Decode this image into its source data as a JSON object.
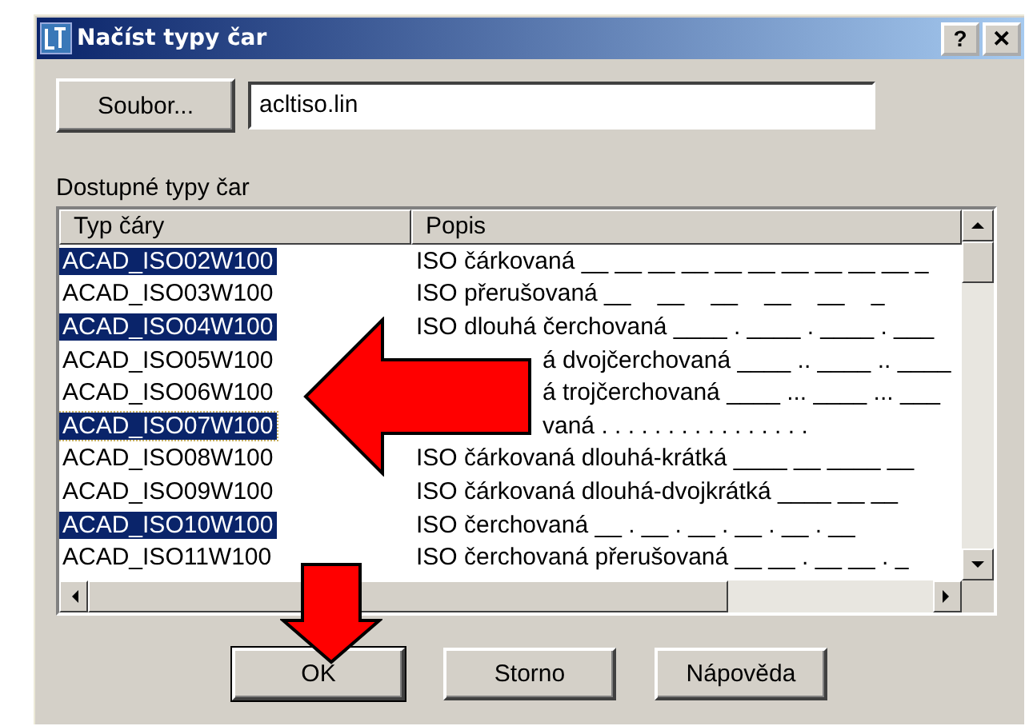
{
  "window": {
    "title": "Načíst typy čar",
    "buttons": [
      "?",
      "✕"
    ]
  },
  "file_button": "Soubor...",
  "file_field": {
    "value": "acltiso.lin"
  },
  "list_label": "Dostupné typy čar",
  "table": {
    "columns": [
      "Typ čáry",
      "Popis"
    ],
    "rows": [
      {
        "name": "ACAD_ISO02W100",
        "description": "ISO čárkovaná __ __ __ __ __ __ __ __ __ __ _",
        "selected": true,
        "focused": false,
        "partly_hidden": false
      },
      {
        "name": "ACAD_ISO03W100",
        "description": "ISO přerušovaná __    __    __    __    __    _",
        "selected": false,
        "focused": false,
        "partly_hidden": false
      },
      {
        "name": "ACAD_ISO04W100",
        "description": "ISO dlouhá čerchovaná ____ . ____ . ____ . ___",
        "selected": true,
        "focused": false,
        "partly_hidden": false
      },
      {
        "name": "ACAD_ISO05W100",
        "description": "á dvojčerchovaná ____ .. ____ .. ____",
        "selected": false,
        "focused": false,
        "partly_hidden": true
      },
      {
        "name": "ACAD_ISO06W100",
        "description": "á trojčerchovaná ____ ... ____ ... ___",
        "selected": false,
        "focused": false,
        "partly_hidden": true
      },
      {
        "name": "ACAD_ISO07W100",
        "description": "vaná . . . . . . . . . . . . . . . .",
        "selected": true,
        "focused": true,
        "partly_hidden": true
      },
      {
        "name": "ACAD_ISO08W100",
        "description": "ISO čárkovaná dlouhá-krátká ____ __ ____ __",
        "selected": false,
        "focused": false,
        "partly_hidden": false
      },
      {
        "name": "ACAD_ISO09W100",
        "description": "ISO čárkovaná dlouhá-dvojkrátká ____ __ __",
        "selected": false,
        "focused": false,
        "partly_hidden": false
      },
      {
        "name": "ACAD_ISO10W100",
        "description": "ISO čerchovaná __ . __ . __ . __ . __ . __",
        "selected": true,
        "focused": false,
        "partly_hidden": false
      },
      {
        "name": "ACAD_ISO11W100",
        "description": "ISO čerchovaná přerušovaná __ __ . __ __ . _",
        "selected": false,
        "focused": false,
        "partly_hidden": false
      }
    ]
  },
  "buttons": [
    {
      "label": "OK",
      "default": true
    },
    {
      "label": "Storno",
      "default": false
    },
    {
      "label": "Nápověda",
      "default": false
    }
  ]
}
